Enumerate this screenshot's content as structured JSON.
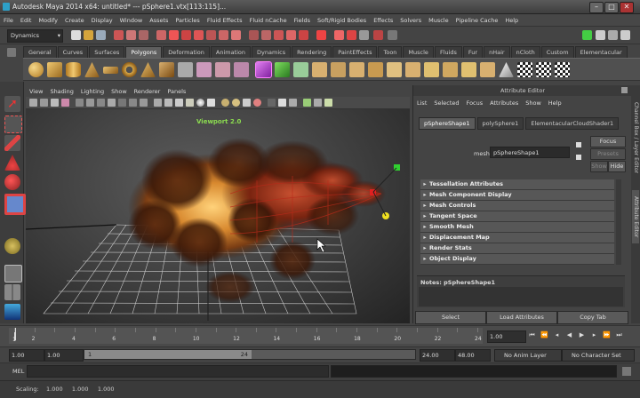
{
  "window": {
    "title": "Autodesk Maya 2014 x64: untitled*   ---   pSphere1.vtx[113:115]...",
    "min": "–",
    "max": "□",
    "close": "✕"
  },
  "menubar": [
    "File",
    "Edit",
    "Modify",
    "Create",
    "Display",
    "Window",
    "Assets",
    "Particles",
    "Fluid Effects",
    "Fluid nCache",
    "Fields",
    "Soft/Rigid Bodies",
    "Effects",
    "Solvers",
    "Muscle",
    "Pipeline Cache",
    "Help"
  ],
  "statusline": {
    "menuset": "Dynamics"
  },
  "shelf": {
    "tabs": [
      "General",
      "Curves",
      "Surfaces",
      "Polygons",
      "Deformation",
      "Animation",
      "Dynamics",
      "Rendering",
      "PaintEffects",
      "Toon",
      "Muscle",
      "Fluids",
      "Fur",
      "nHair",
      "nCloth",
      "Custom",
      "Elementacular"
    ],
    "active": "Polygons"
  },
  "viewport": {
    "menu": [
      "View",
      "Shading",
      "Lighting",
      "Show",
      "Renderer",
      "Panels"
    ],
    "label": "Viewport 2.0"
  },
  "attribute_editor": {
    "header": "Attribute Editor",
    "menu": [
      "List",
      "Selected",
      "Focus",
      "Attributes",
      "Show",
      "Help"
    ],
    "tabs": [
      "pSphereShape1",
      "polySphere1",
      "ElementacularCloudShader1"
    ],
    "active_tab": "pSphereShape1",
    "mesh_label": "mesh:",
    "mesh_value": "pSphereShape1",
    "focus": "Focus",
    "presets": "Presets",
    "show": "Show",
    "hide": "Hide",
    "sections": [
      "Tessellation Attributes",
      "Mesh Component Display",
      "Mesh Controls",
      "Tangent Space",
      "Smooth Mesh",
      "Displacement Map",
      "Render Stats",
      "Object Display"
    ],
    "notes": "Notes:  pSphereShape1",
    "buttons": [
      "Select",
      "Load Attributes",
      "Copy Tab"
    ]
  },
  "side_tabs": [
    "Channel Box / Layer Editor",
    "Attribute Editor"
  ],
  "time_slider": {
    "ticks": [
      "2",
      "4",
      "6",
      "8",
      "10",
      "12",
      "14",
      "16",
      "18",
      "20",
      "22",
      "24"
    ],
    "current_frame": "1",
    "current_field": "1.00"
  },
  "range_slider": {
    "start": "1.00",
    "start2": "1.00",
    "range_start": "1",
    "range_end": "24",
    "end": "24.00",
    "end2": "48.00",
    "anim_layer": "No Anim Layer",
    "character": "No Character Set"
  },
  "command_line": {
    "label": "MEL"
  },
  "help_line": {
    "text": "Scaling:    1.000     1.000     1.000"
  },
  "colors": {
    "accent": "#5ec8ff",
    "cloud": "#d0823a",
    "grid": "#d8d8d8"
  }
}
